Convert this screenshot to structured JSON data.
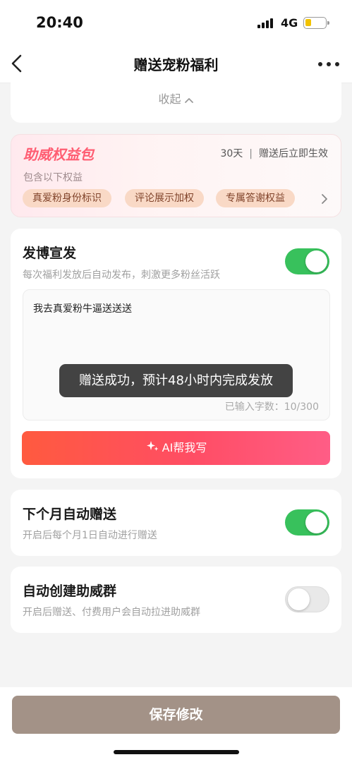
{
  "status_bar": {
    "time": "20:40",
    "network": "4G"
  },
  "nav": {
    "title": "赠送宠粉福利"
  },
  "collapse": {
    "label": "收起"
  },
  "benefit": {
    "title": "助威权益包",
    "duration": "30天",
    "effect": "赠送后立即生效",
    "subtitle": "包含以下权益",
    "chips": [
      "真爱粉身份标识",
      "评论展示加权",
      "专属答谢权益"
    ]
  },
  "post": {
    "title": "发博宣发",
    "desc": "每次福利发放后自动发布，刺激更多粉丝活跃",
    "enabled": true,
    "text": "我去真爱粉牛逼送送送",
    "char_count_label": "已输入字数：10/300",
    "ai_button_label": "AI帮我写"
  },
  "auto_gift": {
    "title": "下个月自动赠送",
    "desc": "开启后每个月1日自动进行赠送",
    "enabled": true
  },
  "auto_group": {
    "title": "自动创建助威群",
    "desc": "开启后赠送、付费用户会自动拉进助威群",
    "enabled": false
  },
  "toast": {
    "message": "赠送成功，预计48小时内完成发放"
  },
  "footer": {
    "save_label": "保存修改"
  },
  "colors": {
    "accent_gradient_start": "#ff5a3f",
    "accent_gradient_end": "#ff5d86",
    "toggle_on": "#38c15c",
    "save_button": "#a39287",
    "benefit_title": "#ff5d72"
  },
  "icons": {
    "back": "chevron-left-icon",
    "more": "more-dots-icon",
    "collapse": "chevron-up-icon",
    "chips_more": "chevron-right-icon",
    "ai": "sparkle-icon"
  }
}
